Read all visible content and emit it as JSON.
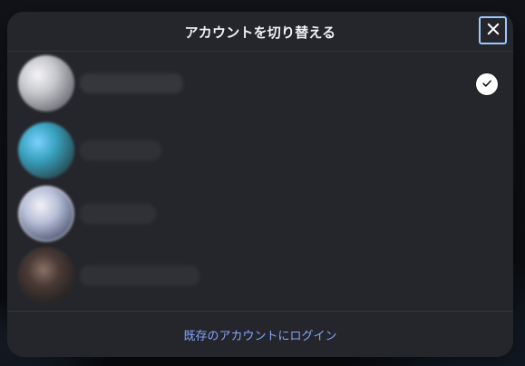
{
  "dialog": {
    "title": "アカウントを切り替える",
    "close_icon": "close-icon",
    "accounts": [
      {
        "selected": true
      },
      {
        "selected": false
      },
      {
        "selected": false
      },
      {
        "selected": false
      }
    ],
    "footer_link": "既存のアカウントにログイン"
  },
  "colors": {
    "modal_bg": "#25262b",
    "divider": "#34353b",
    "title_text": "#f2f3f6",
    "link_text": "#8aa4ff",
    "close_focus_ring": "#9ec7ff"
  },
  "icons": {
    "selected": "check-icon"
  }
}
